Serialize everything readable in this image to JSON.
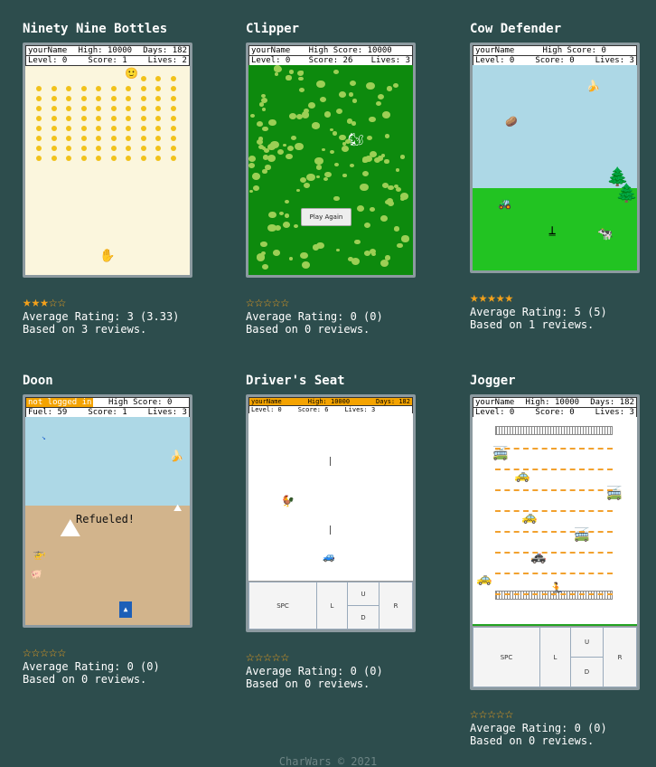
{
  "games": [
    {
      "id": "nnb",
      "title": "Ninety Nine Bottles",
      "hud": [
        [
          "yourName",
          "High: 10000",
          "Days: 182"
        ],
        [
          "Level: 0",
          "Score: 1",
          "Lives: 2"
        ]
      ],
      "stars": "★★★☆☆",
      "average": "Average Rating: 3 (3.33)",
      "reviews": "Based on 3 reviews.",
      "colors": {
        "bg": "#fbf6dd",
        "dot": "#f1c21b"
      }
    },
    {
      "id": "clipper",
      "title": "Clipper",
      "hud": [
        [
          "yourName",
          "High Score: 10000",
          ""
        ],
        [
          "Level: 0",
          "Score: 26",
          "Lives: 3"
        ]
      ],
      "play_again": "Play Again",
      "stars": "☆☆☆☆☆",
      "average": "Average Rating: 0 (0)",
      "reviews": "Based on 0 reviews.",
      "colors": {
        "bg": "#0d8a0d",
        "bush": "#9ccf55"
      }
    },
    {
      "id": "cow",
      "title": "Cow Defender",
      "hud": [
        [
          "yourName",
          "High Score: 0",
          ""
        ],
        [
          "Level: 0",
          "Score: 0",
          "Lives: 3"
        ]
      ],
      "stars": "★★★★★",
      "average": "Average Rating: 5 (5)",
      "reviews": "Based on 1 reviews.",
      "colors": {
        "sky": "#add8e6",
        "grass": "#22c322"
      }
    },
    {
      "id": "doon",
      "title": "Doon",
      "hud": [
        [
          "not logged in",
          "High Score: 0",
          ""
        ],
        [
          "Fuel: 59",
          "Score: 1",
          "Lives: 3"
        ]
      ],
      "message": "Refueled!",
      "stars": "☆☆☆☆☆",
      "average": "Average Rating: 0 (0)",
      "reviews": "Based on 0 reviews.",
      "colors": {
        "sky": "#add8e6",
        "sand": "#d2b48c",
        "badge": "#f4a300"
      }
    },
    {
      "id": "drivers",
      "title": "Driver's Seat",
      "hud": [
        [
          "yourName",
          "High: 10000",
          "Days: 182"
        ],
        [
          "Level: 0",
          "Score: 6",
          "Lives: 3"
        ]
      ],
      "controls": {
        "spc": "SPC",
        "l": "L",
        "u": "U",
        "d": "D",
        "r": "R"
      },
      "stars": "☆☆☆☆☆",
      "average": "Average Rating: 0 (0)",
      "reviews": "Based on 0 reviews.",
      "colors": {
        "hudbar": "#f4a300"
      }
    },
    {
      "id": "jogger",
      "title": "Jogger",
      "hud": [
        [
          "yourName",
          "High: 10000",
          "Days: 182"
        ],
        [
          "Level: 0",
          "Score: 0",
          "Lives: 3"
        ]
      ],
      "controls": {
        "spc": "SPC",
        "l": "L",
        "u": "U",
        "d": "D",
        "r": "R"
      },
      "stars": "☆☆☆☆☆",
      "average": "Average Rating: 0 (0)",
      "reviews": "Based on 0 reviews.",
      "colors": {
        "lane": "#f2a12e",
        "grass": "#22a322"
      }
    }
  ],
  "footer": "CharWars © 2021"
}
